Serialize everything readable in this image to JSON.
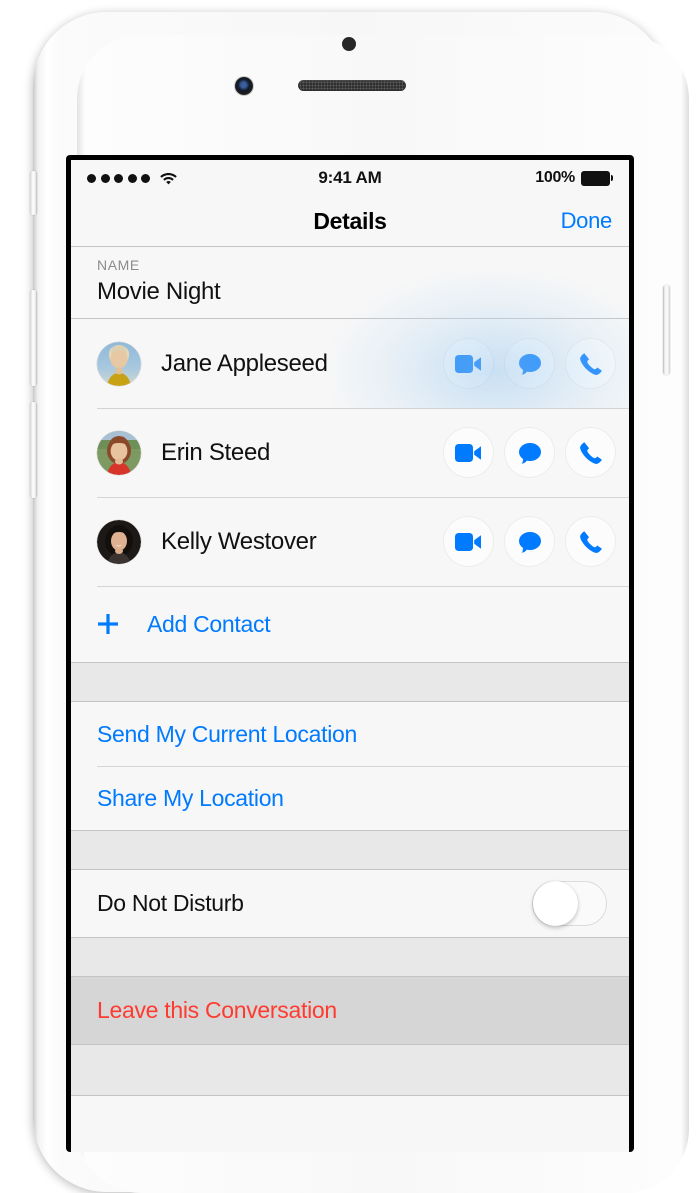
{
  "status_bar": {
    "signal_dots": 5,
    "wifi_icon": "wifi-icon",
    "time": "9:41 AM",
    "battery_percent": "100%",
    "battery_icon": "battery-full-icon"
  },
  "nav_bar": {
    "title": "Details",
    "done_label": "Done"
  },
  "name_section": {
    "label": "NAME",
    "value": "Movie Night"
  },
  "contacts": [
    {
      "name": "Jane Appleseed",
      "avatar_alt": "jane-appleseed-avatar",
      "actions": [
        "video-call-icon",
        "message-icon",
        "phone-call-icon"
      ]
    },
    {
      "name": "Erin Steed",
      "avatar_alt": "erin-steed-avatar",
      "actions": [
        "video-call-icon",
        "message-icon",
        "phone-call-icon"
      ]
    },
    {
      "name": "Kelly Westover",
      "avatar_alt": "kelly-westover-avatar",
      "actions": [
        "video-call-icon",
        "message-icon",
        "phone-call-icon"
      ]
    }
  ],
  "add_contact": {
    "icon": "plus-icon",
    "label": "Add Contact"
  },
  "location_actions": [
    {
      "label": "Send My Current Location"
    },
    {
      "label": "Share My Location"
    }
  ],
  "do_not_disturb": {
    "label": "Do Not Disturb",
    "state": "off"
  },
  "leave_conversation": {
    "label": "Leave this Conversation"
  },
  "colors": {
    "accent_blue": "#007aff",
    "destructive_red": "#ff3b30",
    "section_background": "#f7f7f7",
    "gap_background": "#e8e8e8",
    "pressed_background": "#d6d6d6"
  }
}
